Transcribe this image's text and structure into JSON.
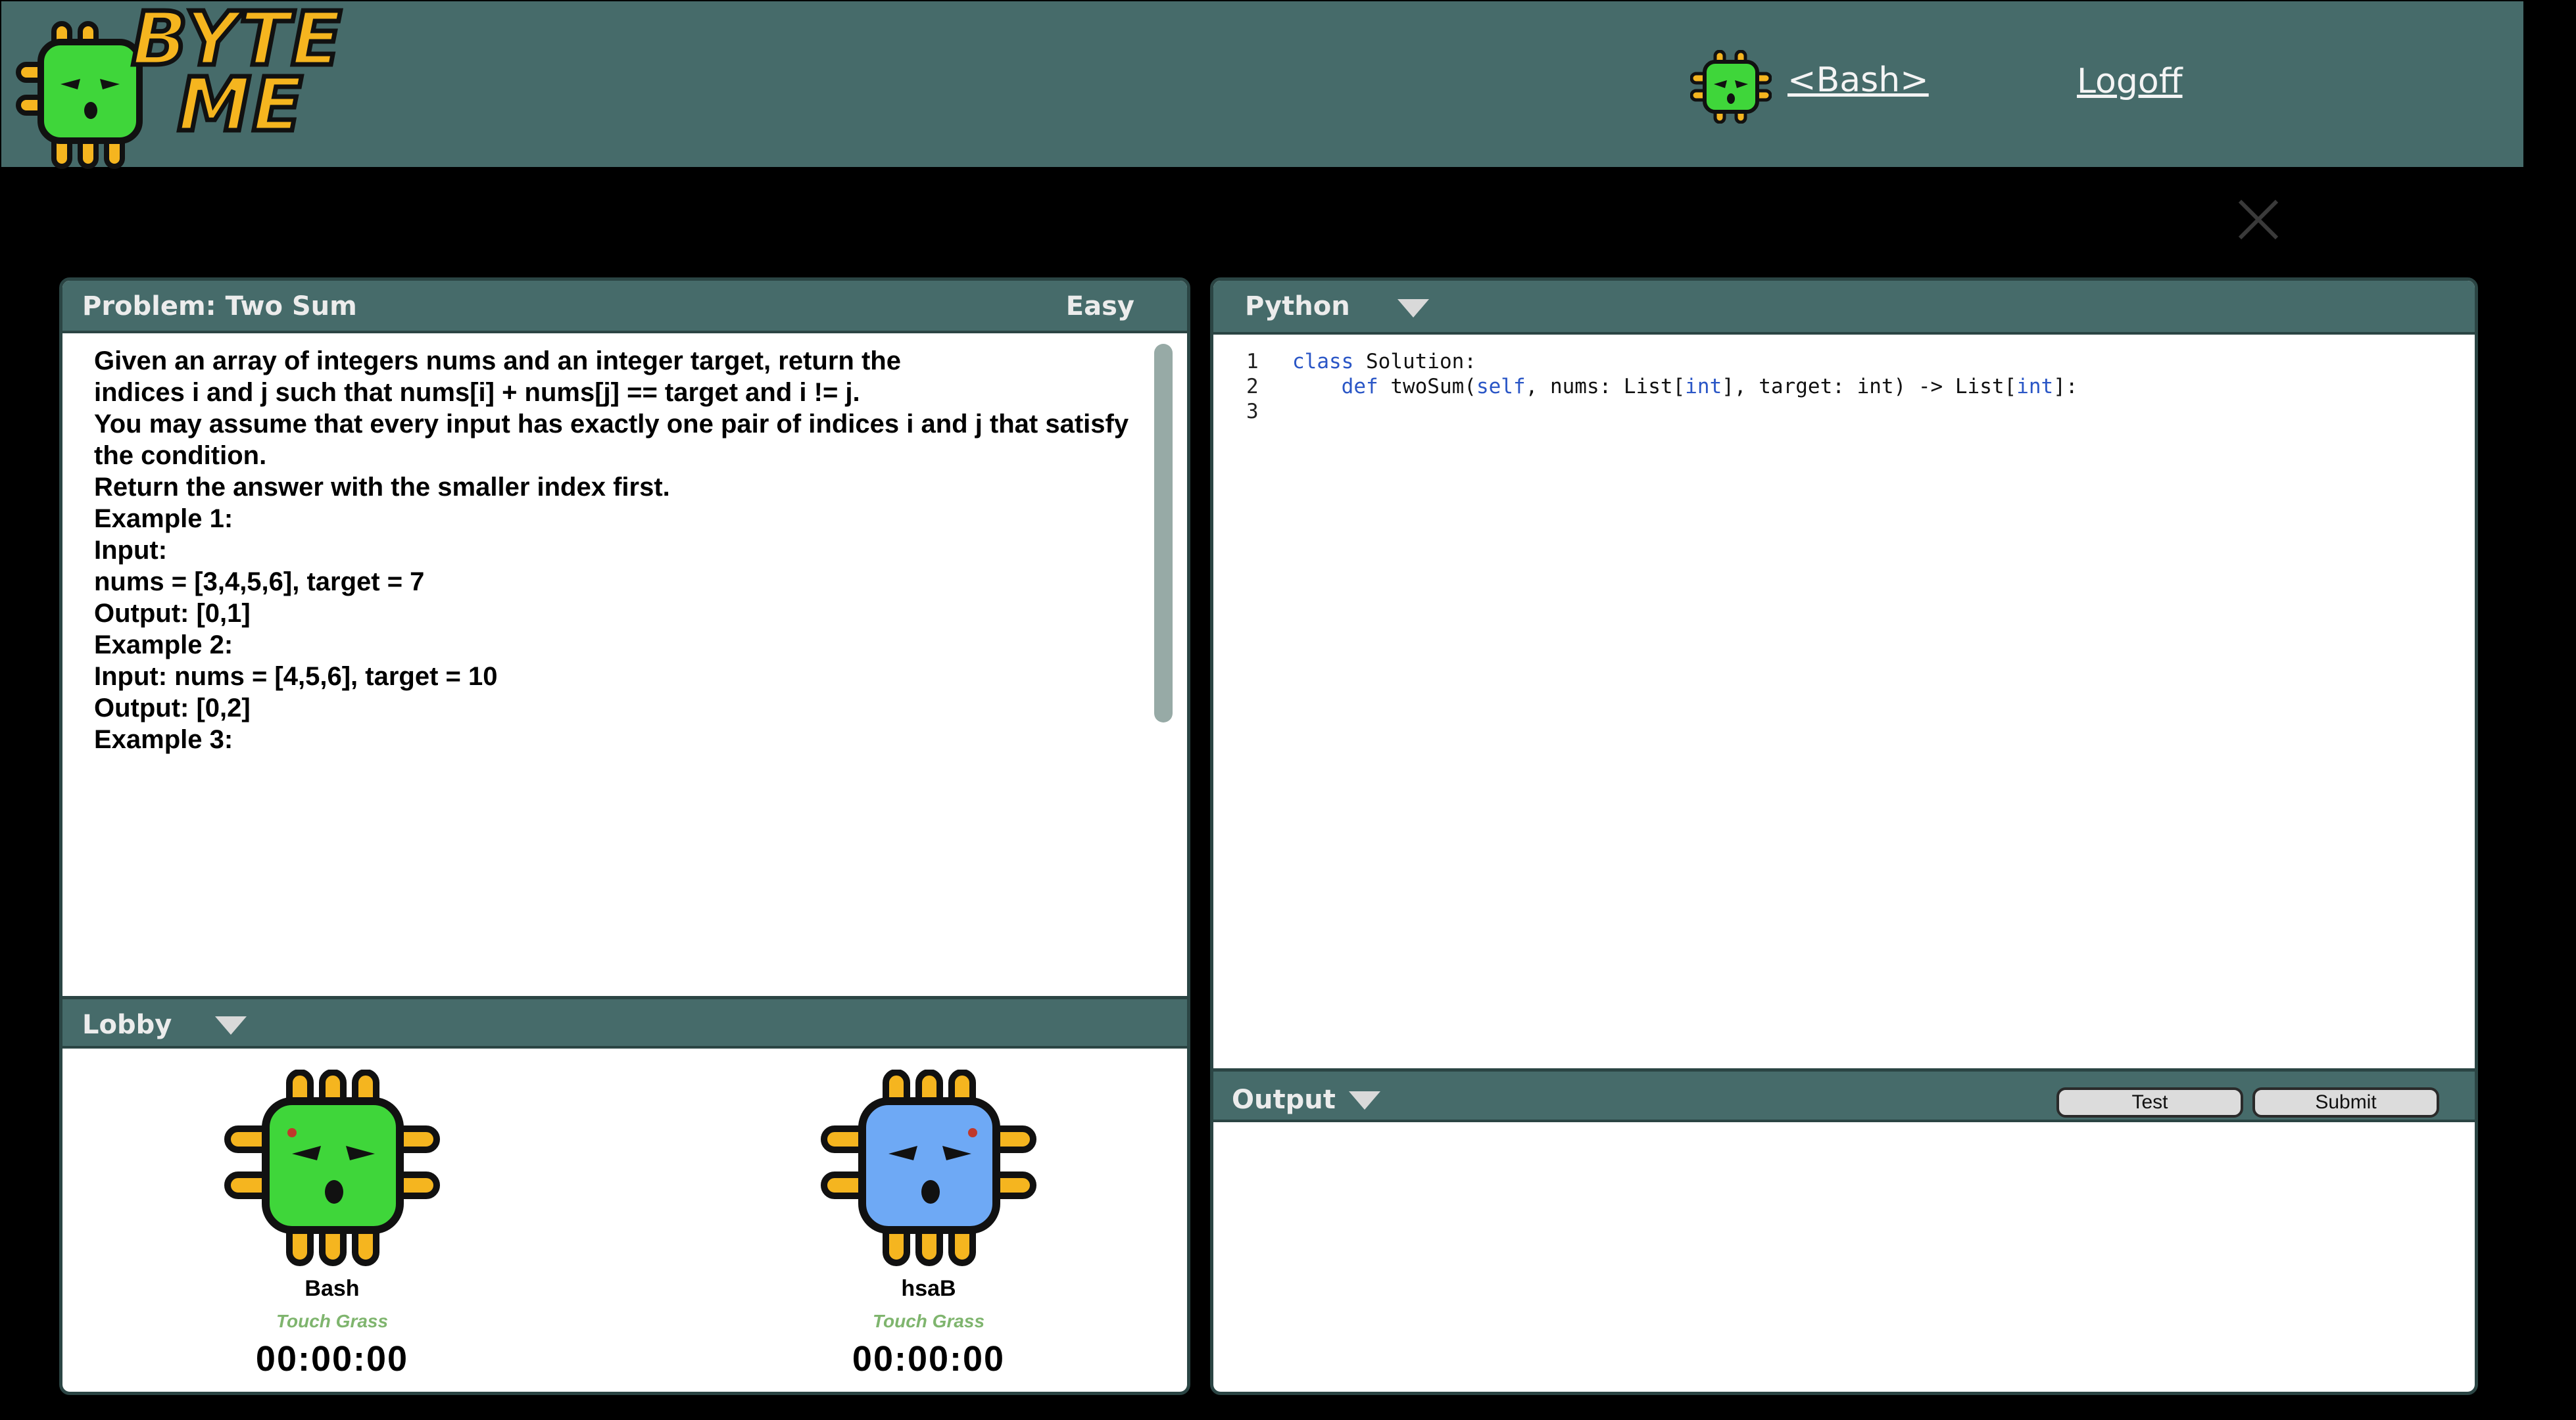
{
  "nav": {
    "brand_line1": "BYTE",
    "brand_line2": "ME",
    "username": "<Bash>",
    "logoff": "Logoff"
  },
  "problem": {
    "title": "Problem: Two Sum",
    "difficulty": "Easy",
    "lines": [
      "Given an array of integers nums and an integer target, return the",
      "indices i and j such that nums[i] + nums[j] == target and i != j.",
      "You may assume that every input has exactly one pair of indices i and j that satisfy",
      "the condition.",
      "Return the answer with the smaller index first.",
      "Example 1:",
      "Input:",
      "nums = [3,4,5,6], target = 7",
      "",
      "Output: [0,1]",
      "Example 2:",
      "Input: nums = [4,5,6], target = 10",
      "",
      "Output: [0,2]",
      "",
      "",
      "Example 3:"
    ]
  },
  "lobby": {
    "label": "Lobby",
    "players": [
      {
        "name": "Bash",
        "status": "Touch Grass",
        "time": "00:00:00",
        "color": "#3fd63a"
      },
      {
        "name": "hsaB",
        "status": "Touch Grass",
        "time": "00:00:00",
        "color": "#6ea9f5"
      }
    ]
  },
  "editor": {
    "language": "Python",
    "code": [
      {
        "n": "1",
        "pre": "",
        "kw1": "class",
        "rest1": " Solution:",
        "kw2": "",
        "rest2": "",
        "kw3": "",
        "rest3": "",
        "kw4": "",
        "rest4": ""
      },
      {
        "n": "2",
        "pre": "    ",
        "kw1": "def",
        "rest1": " twoSum(",
        "kw2": "self",
        "rest2": ", nums: List[",
        "kw3": "int",
        "rest3": "], target: int) -> List[",
        "kw4": "int",
        "rest4": "]:"
      },
      {
        "n": "3",
        "pre": "",
        "kw1": "",
        "rest1": "",
        "kw2": "",
        "rest2": "",
        "kw3": "",
        "rest3": "",
        "kw4": "",
        "rest4": ""
      }
    ]
  },
  "output": {
    "label": "Output",
    "test": "Test",
    "submit": "Submit"
  },
  "colors": {
    "header": "#466b6a",
    "border": "#2b4544",
    "brand": "#f5b51f",
    "status": "#7fb56e"
  }
}
